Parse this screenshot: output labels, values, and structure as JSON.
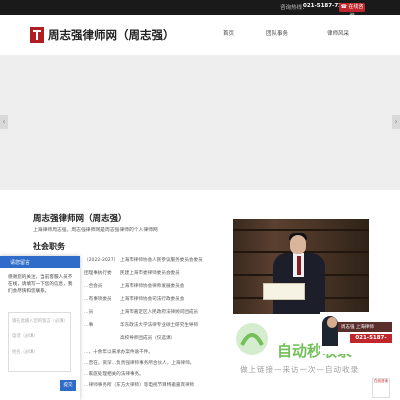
{
  "topbar": {
    "phone_label": "咨询热线：",
    "phone": "021-5187-7200",
    "consult_button": "☎ 在线咨询"
  },
  "header": {
    "site_title": "周志强律师网（周志强）",
    "nav": [
      "首页",
      "团队事务",
      "律师风采"
    ]
  },
  "banner": {
    "prev_arrow": "‹",
    "next_arrow": "›"
  },
  "content": {
    "section_title": "周志强律师网（周志强）",
    "intro": "上海律师周志强，周志强律师网是周志强律师的个人律师网",
    "duties_title": "社会职务",
    "duties_left": [
      "（2022-2027）",
      "团理事执行委",
      "…合会员",
      "…有事项委员",
      "…员",
      "…事"
    ],
    "duties_right": [
      "上海市律师协会人民参议服务委员会委员",
      "民建上海市委律师委员会委员",
      "上海市律师协会律师发展委员会",
      "上海市律师协会司法行政委员会",
      "上海市嘉定区人民政府法律顾问团成员",
      "华东政法大学法律专业硕士研究生导师",
      "高校导师团成员（仅选课）"
    ],
    "bio": [
      "…，十余年以来承办案件逾千件。",
      "…曾在，资深…负责强律师事务所合伙人，上海律师。",
      "…家庭处理相关的法律事务。",
      "…律师事务所（东方大律师）等电视节目特邀嘉宾律师"
    ]
  },
  "chat": {
    "title": "请您留言",
    "message": "感谢您的关注，当前客服人员不在线，请填写一下您的信息，我们会尽快和您联系。",
    "fields": [
      "请在此输入您的留言（必填）",
      "电话（必填）",
      "姓名（必填）"
    ],
    "send": "提交"
  },
  "promo": {
    "name": "周志强 上海律师",
    "phone": "021-5187-7200"
  },
  "watermark": {
    "text": "自动秒收录",
    "sub": "做上链接—来访一次—自动收录"
  },
  "floating": {
    "label": "在线咨询"
  }
}
